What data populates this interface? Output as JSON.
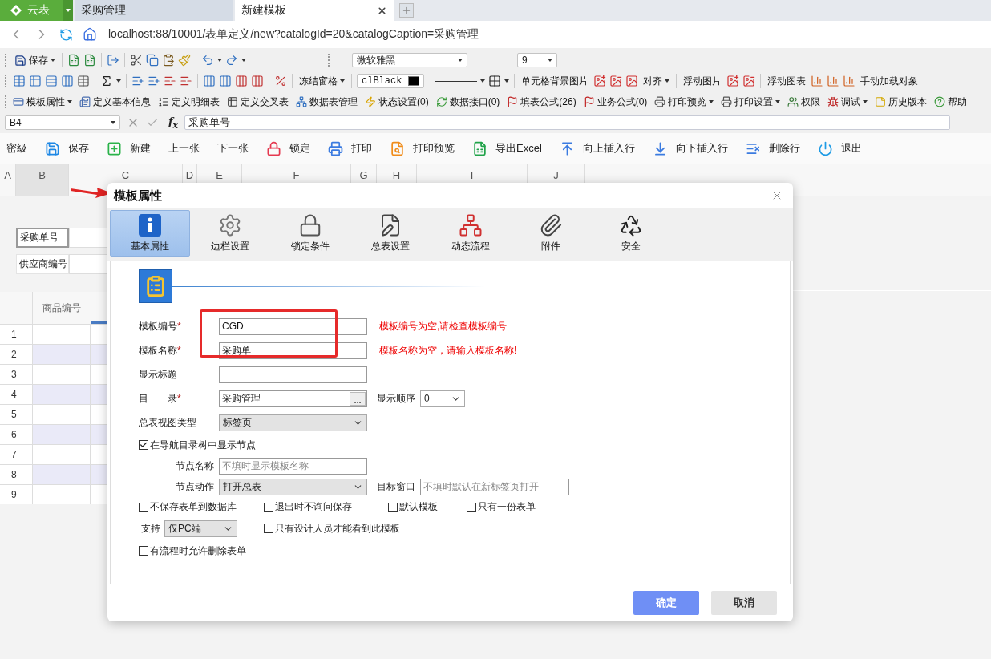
{
  "browser_tabs": {
    "app_label": "云表",
    "tabs": [
      {
        "label": "采购管理",
        "selected": false
      },
      {
        "label": "新建模板",
        "selected": true
      }
    ]
  },
  "address_bar": {
    "url": "localhost:88/10001/表单定义/new?catalogId=20&catalogCaption=采购管理"
  },
  "toolbar_1": {
    "save": {
      "label": "保存",
      "menu": true
    },
    "font": "微软雅黑",
    "font_size": "9"
  },
  "toolbar_2": {
    "color_name": "clBlack",
    "items": [
      {
        "label": "冻结窗格",
        "menu": true
      },
      {
        "label": "单元格背景图片",
        "menu": false
      },
      {
        "label": "对齐",
        "menu": true
      },
      {
        "label": "浮动图片",
        "menu": false
      },
      {
        "label": "浮动图表",
        "menu": false
      },
      {
        "label": "手动加载对象",
        "menu": false
      }
    ]
  },
  "toolbar_3": {
    "items": [
      {
        "label": "模板属性",
        "menu": true
      },
      {
        "label": "定义基本信息",
        "menu": false
      },
      {
        "label": "定义明细表",
        "menu": false
      },
      {
        "label": "定义交叉表",
        "menu": false
      },
      {
        "label": "数据表管理",
        "menu": false
      },
      {
        "label": "状态设置(0)",
        "menu": false
      },
      {
        "label": "数据接口(0)",
        "menu": false
      },
      {
        "label": "填表公式(26)",
        "menu": false
      },
      {
        "label": "业务公式(0)",
        "menu": false
      },
      {
        "label": "打印预览",
        "menu": true
      },
      {
        "label": "打印设置",
        "menu": true
      },
      {
        "label": "权限",
        "menu": false
      },
      {
        "label": "调试",
        "menu": true
      },
      {
        "label": "历史版本",
        "menu": false
      },
      {
        "label": "帮助",
        "menu": false
      }
    ]
  },
  "formula_bar": {
    "cell": "B4",
    "function_label": "f$_{x}$",
    "value": "采购单号"
  },
  "action_bar": {
    "items": [
      "密級",
      "保存",
      "新建",
      "上一张",
      "下一张",
      "锁定",
      "打印",
      "打印预览",
      "导出Excel",
      "向上插入行",
      "向下插入行",
      "删除行",
      "退出"
    ]
  },
  "sheet": {
    "columns": [
      {
        "label": "A",
        "selected": false
      },
      {
        "label": "B",
        "selected": true
      },
      {
        "label": "C",
        "selected": false
      },
      {
        "label": "D",
        "selected": false
      },
      {
        "label": "E",
        "selected": false
      },
      {
        "label": "F",
        "selected": false
      },
      {
        "label": "G",
        "selected": false
      },
      {
        "label": "H",
        "selected": false
      },
      {
        "label": "I",
        "selected": false
      },
      {
        "label": "J",
        "selected": false
      }
    ],
    "header_fields": [
      {
        "label": "采购单号",
        "selected": true
      },
      {
        "label": "供应商编号",
        "selected": false
      }
    ],
    "detail": {
      "column": "商品编号",
      "rows": [
        "1",
        "2",
        "3",
        "4",
        "5",
        "6",
        "7",
        "8",
        "9"
      ]
    }
  },
  "dialog": {
    "title": "模板属性",
    "tabs": [
      {
        "label": "基本属性",
        "selected": true
      },
      {
        "label": "边栏设置",
        "selected": false
      },
      {
        "label": "锁定条件",
        "selected": false
      },
      {
        "label": "总表设置",
        "selected": false
      },
      {
        "label": "动态流程",
        "selected": false
      },
      {
        "label": "附件",
        "selected": false
      },
      {
        "label": "安全",
        "selected": false
      }
    ],
    "form": {
      "template_code": {
        "label": "模板编号",
        "required_mark": "*",
        "value": "CGD",
        "error": "模板编号为空,请检查模板编号"
      },
      "template_name": {
        "label": "模板名称",
        "required_mark": "*",
        "value": "采购单",
        "error": "模板名称为空，请输入模板名称!"
      },
      "display_title": {
        "label": "显示标题"
      },
      "catalog": {
        "label": "目　　录",
        "required_mark": "*",
        "value": "采购管理",
        "browse": "..."
      },
      "order": {
        "label": "显示顺序",
        "value": "0"
      },
      "view_type": {
        "label": "总表视图类型",
        "value": "标签页"
      },
      "show_node": {
        "label": "在导航目录树中显示节点",
        "checked": true
      },
      "node_name": {
        "label": "节点名称",
        "placeholder": "不填时显示模板名称"
      },
      "node_action": {
        "label": "节点动作",
        "value": "打开总表"
      },
      "target_window": {
        "label": "目标窗口",
        "placeholder": "不填时默认在新标签页打开"
      },
      "options_1": [
        {
          "label": "不保存表单到数据库",
          "checked": false
        },
        {
          "label": "退出时不询问保存",
          "checked": false
        },
        {
          "label": "默认模板",
          "checked": false
        },
        {
          "label": "只有一份表单",
          "checked": false
        }
      ],
      "support": {
        "label": "支持",
        "value": "仅PC端"
      },
      "options_2": [
        {
          "label": "只有设计人员才能看到此模板",
          "checked": false
        }
      ],
      "options_3": [
        {
          "label": "有流程时允许删除表单",
          "checked": false
        }
      ]
    },
    "buttons": [
      {
        "label": "确定",
        "kind": "primary"
      },
      {
        "label": "取消",
        "kind": "secondary"
      }
    ]
  }
}
